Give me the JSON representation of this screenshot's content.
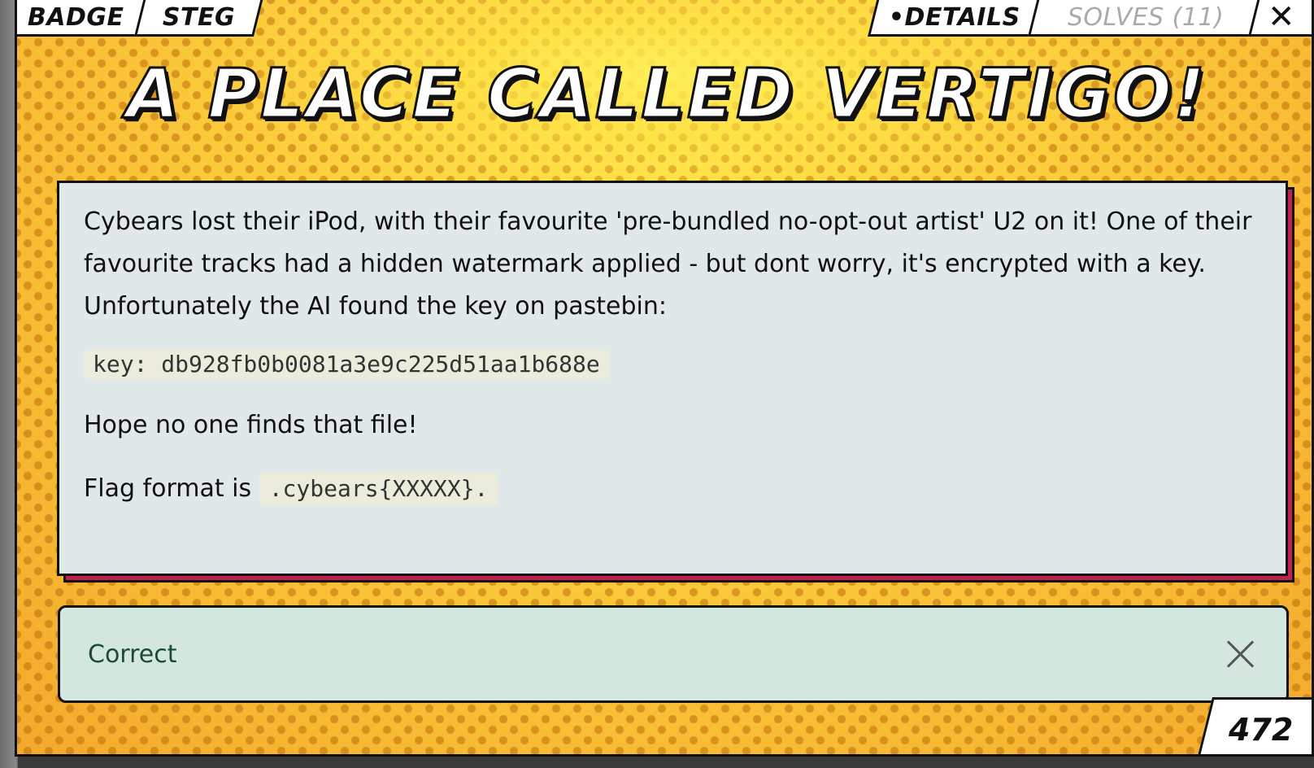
{
  "tabs": {
    "badge": "BADGE",
    "steg": "STEG",
    "details": "•DETAILS",
    "solves": "SOLVES (11)",
    "close": "✕"
  },
  "challenge": {
    "title": "A PLACE CALLED VERTIGO!",
    "description_line": "Cybears lost their iPod, with their favourite 'pre-bundled no-opt-out artist' U2 on it! One of their favourite tracks had a hidden watermark applied - but dont worry, it's encrypted with a key. Unfortunately the AI found the key on pastebin:",
    "key_code": "key: db928fb0b0081a3e9c225d51aa1b688e",
    "hope_text": "Hope no one finds that file!",
    "flag_prefix": "Flag format is ",
    "flag_code": ".cybears{XXXXX}.",
    "points": "472"
  },
  "alert": {
    "status": "Correct",
    "close_icon": "close-icon"
  },
  "colors": {
    "background_yellow": "#fbc93a",
    "panel_bg": "#e1e8e9",
    "panel_shadow": "#c22050",
    "alert_bg": "#d4e7df",
    "alert_text": "#1d4a33"
  }
}
